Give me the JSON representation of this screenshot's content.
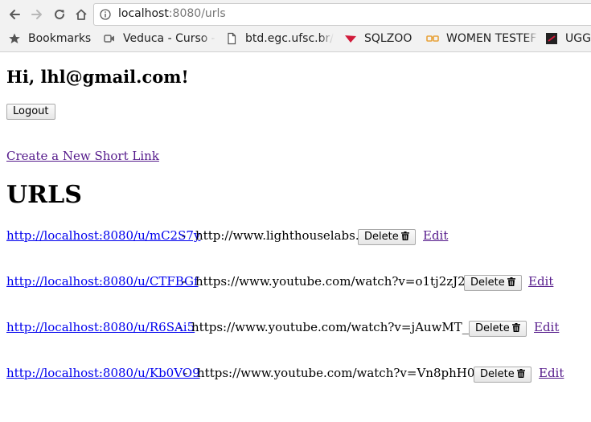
{
  "browser": {
    "url_host": "localhost",
    "url_rest": ":8080/urls",
    "bookmarks": [
      {
        "label": "Bookmarks",
        "icon": "star-icon"
      },
      {
        "label": "Veduca - Curso -",
        "icon": "video-camera-icon"
      },
      {
        "label": "btd.egc.ufsc.br/",
        "icon": "document-icon"
      },
      {
        "label": "SQLZOO",
        "icon": "sqlzoo-icon"
      },
      {
        "label": "WOMEN TESTEF",
        "icon": "glasses-icon"
      },
      {
        "label": "UGG",
        "icon": "ugg-icon"
      }
    ]
  },
  "header": {
    "greeting": "Hi, lhl@gmail.com!",
    "logout_label": "Logout",
    "create_link": "Create a New Short Link"
  },
  "urls": {
    "title": "URLS",
    "separator": "-",
    "delete_label": "Delete",
    "edit_label": "Edit",
    "rows": [
      {
        "short": "http://localhost:8080/u/mC2S7y",
        "long": "http://www.lighthouselabs.ca"
      },
      {
        "short": "http://localhost:8080/u/CTFBGf",
        "long": "https://www.youtube.com/watch?v=o1tj2zJ2Wvg"
      },
      {
        "short": "http://localhost:8080/u/R6SAi5",
        "long": "https://www.youtube.com/watch?v=jAuwMT__wjI"
      },
      {
        "short": "http://localhost:8080/u/Kb0VO9",
        "long": "https://www.youtube.com/watch?v=Vn8phH0k5HI"
      }
    ]
  }
}
